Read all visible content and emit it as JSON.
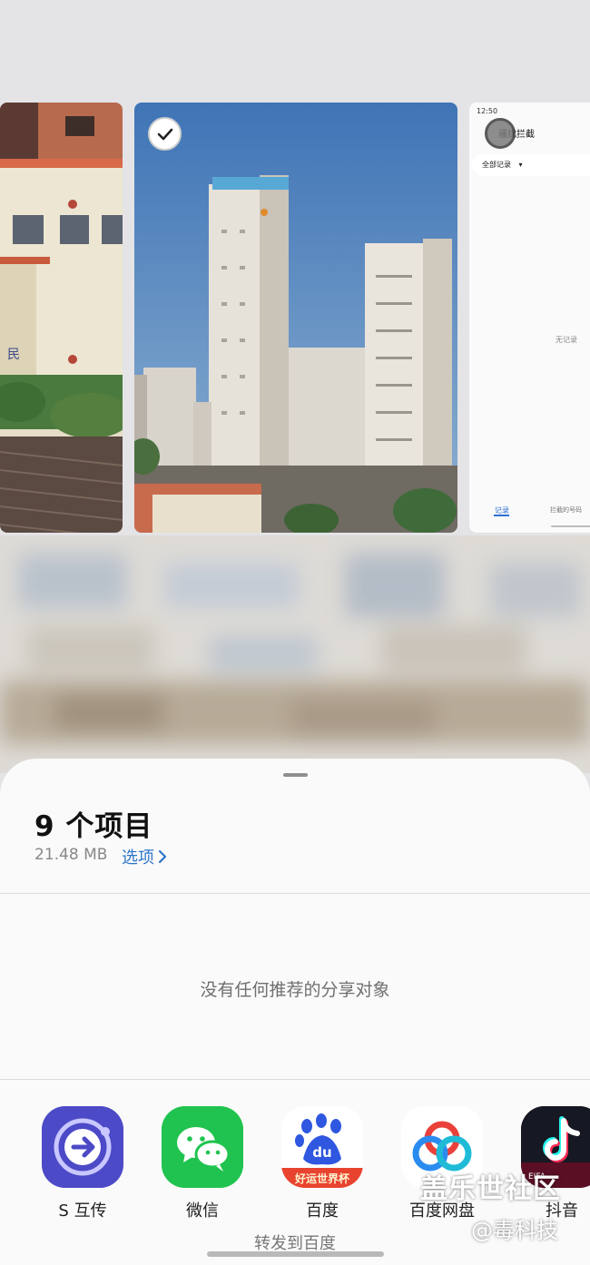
{
  "recents": {
    "left_thumb_text": "民",
    "right_thumb": {
      "status_time": "12:50",
      "title": "骚扰拦截",
      "filter_label": "全部记录",
      "empty_text": "无记录",
      "tab_records": "记录",
      "tab_blocked_numbers": "拦截的号码"
    }
  },
  "share_sheet": {
    "title": "9 个项目",
    "size": "21.48 MB",
    "options_label": "选项",
    "no_targets_text": "没有任何推荐的分享对象",
    "apps": [
      {
        "label": "S 互传",
        "icon": "s-transfer-icon",
        "color": "#5a56d6"
      },
      {
        "label": "微信",
        "icon": "wechat-icon",
        "color": "#1fc54c"
      },
      {
        "label": "百度",
        "icon": "baidu-icon",
        "color": "#2f57e0",
        "badge": "好运世界杯"
      },
      {
        "label": "百度网盘",
        "icon": "baidu-netdisk-icon",
        "color": "#2b8cf0"
      },
      {
        "label": "抖音",
        "icon": "douyin-icon",
        "color": "#161823",
        "badge": "EIFA"
      }
    ],
    "baidu_subtitle": "转发到百度"
  },
  "watermark": {
    "line1": "盖乐世社区",
    "line2": "@毒科技"
  }
}
